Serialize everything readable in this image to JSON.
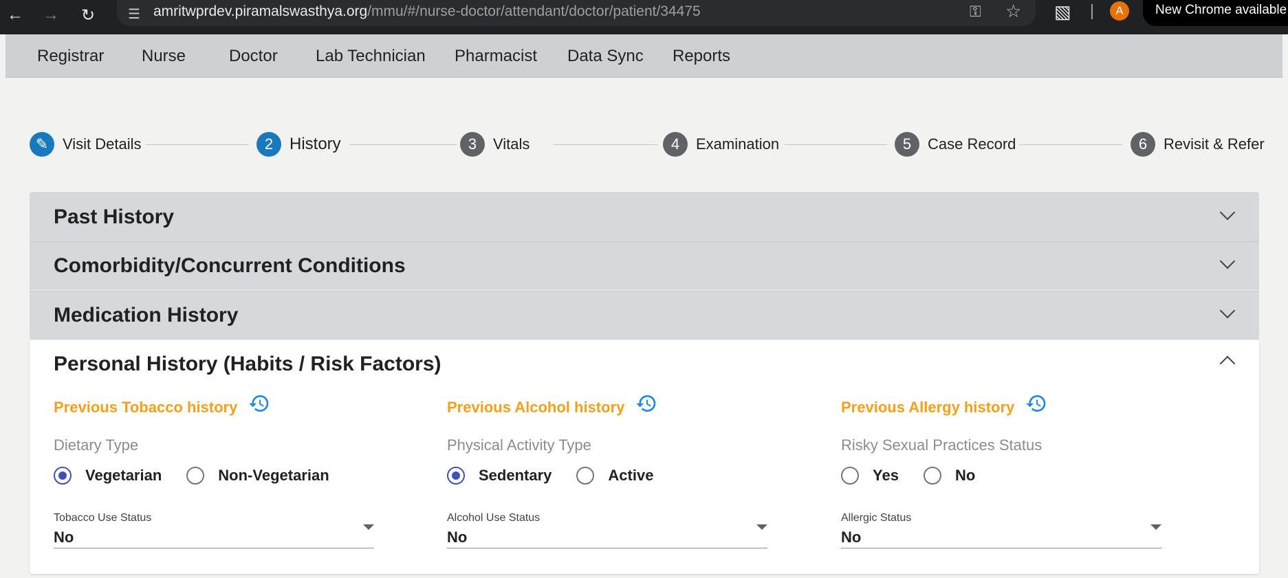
{
  "browser": {
    "url_host": "amritwprdev.piramalswasthya.org",
    "url_path": "/mmu/#/nurse-doctor/attendant/doctor/patient/34475",
    "profile_initial": "A",
    "update_label": "New Chrome available"
  },
  "nav": {
    "items": [
      "Registrar",
      "Nurse",
      "Doctor",
      "Lab Technician",
      "Pharmacist",
      "Data Sync",
      "Reports"
    ]
  },
  "stepper": {
    "steps": [
      {
        "number": "",
        "label": "Visit Details"
      },
      {
        "number": "2",
        "label": "History"
      },
      {
        "number": "3",
        "label": "Vitals"
      },
      {
        "number": "4",
        "label": "Examination"
      },
      {
        "number": "5",
        "label": "Case Record"
      },
      {
        "number": "6",
        "label": "Revisit & Refer"
      }
    ]
  },
  "panels": {
    "past_history": "Past History",
    "comorbidity": "Comorbidity/Concurrent Conditions",
    "medication": "Medication History",
    "personal": "Personal History (Habits / Risk Factors)"
  },
  "personal": {
    "tobacco": {
      "previous_link": "Previous Tobacco history",
      "field_label": "Dietary Type",
      "options": [
        "Vegetarian",
        "Non-Vegetarian"
      ],
      "selected": "Vegetarian",
      "select_label": "Tobacco Use Status",
      "select_value": "No"
    },
    "alcohol": {
      "previous_link": "Previous Alcohol history",
      "field_label": "Physical Activity Type",
      "options": [
        "Sedentary",
        "Active"
      ],
      "selected": "Sedentary",
      "select_label": "Alcohol Use Status",
      "select_value": "No"
    },
    "allergy": {
      "previous_link": "Previous Allergy history",
      "field_label": "Risky Sexual Practices Status",
      "options": [
        "Yes",
        "No"
      ],
      "selected": "",
      "select_label": "Allergic Status",
      "select_value": "No"
    }
  },
  "colors": {
    "accent_orange": "#f5a01a",
    "step_active": "#1979bf",
    "radio_selected": "#3f51b5"
  }
}
